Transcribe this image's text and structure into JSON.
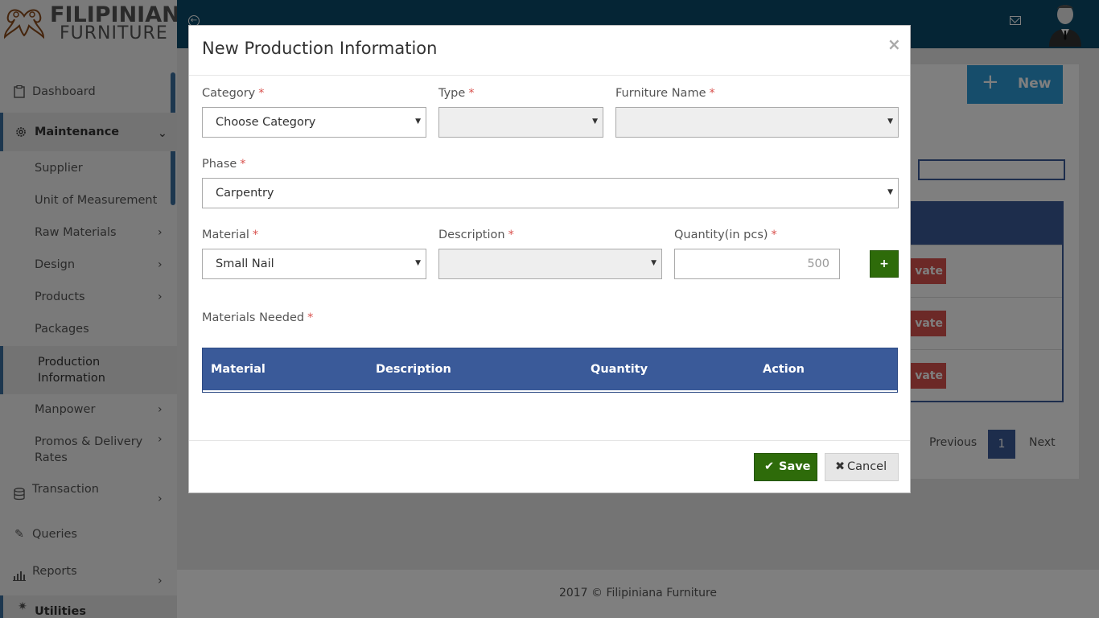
{
  "brand": {
    "line1": "FILIPINIANA",
    "line2": "FURNITURE"
  },
  "sidebar": {
    "items": [
      {
        "label": "Dashboard",
        "icon": "clipboard-icon"
      },
      {
        "label": "Maintenance",
        "icon": "gear-icon"
      },
      {
        "label": "Supplier"
      },
      {
        "label": "Unit of Measurement"
      },
      {
        "label": "Raw Materials"
      },
      {
        "label": "Design"
      },
      {
        "label": "Products"
      },
      {
        "label": "Packages"
      },
      {
        "label": "Production Information"
      },
      {
        "label": "Manpower"
      },
      {
        "label": "Promos & Delivery Rates"
      },
      {
        "label": "Transaction",
        "icon": "database-icon"
      },
      {
        "label": "Queries",
        "icon": "pencil-icon"
      },
      {
        "label": "Reports",
        "icon": "bar-chart-icon"
      },
      {
        "label": "Utilities",
        "icon": "wand-icon"
      }
    ]
  },
  "background": {
    "new_button": "New",
    "row_action": "vate",
    "pager": {
      "previous": "Previous",
      "page": "1",
      "next": "Next"
    },
    "footer": "2017 © Filipiniana Furniture"
  },
  "modal": {
    "title": "New Production Information",
    "close": "×",
    "fields": {
      "category": {
        "label": "Category",
        "value": "Choose Category"
      },
      "type": {
        "label": "Type",
        "value": ""
      },
      "furniture_name": {
        "label": "Furniture Name",
        "value": ""
      },
      "phase": {
        "label": "Phase",
        "value": "Carpentry"
      },
      "material": {
        "label": "Material",
        "value": "Small Nail"
      },
      "description": {
        "label": "Description",
        "value": ""
      },
      "quantity": {
        "label": "Quantity(in pcs)",
        "value": "500"
      }
    },
    "add_button": "+",
    "materials_needed_label": "Materials Needed",
    "required_mark": "*",
    "table_headers": [
      "Material",
      "Description",
      "Quantity",
      "Action"
    ],
    "save_button": "Save",
    "cancel_button": "Cancel"
  },
  "colors": {
    "topbar": "#0b4a6b",
    "accent_blue": "#3a5a99",
    "save_green": "#2e6b0a",
    "danger_red": "#d9534f",
    "new_button_blue": "#2c9bd6"
  }
}
